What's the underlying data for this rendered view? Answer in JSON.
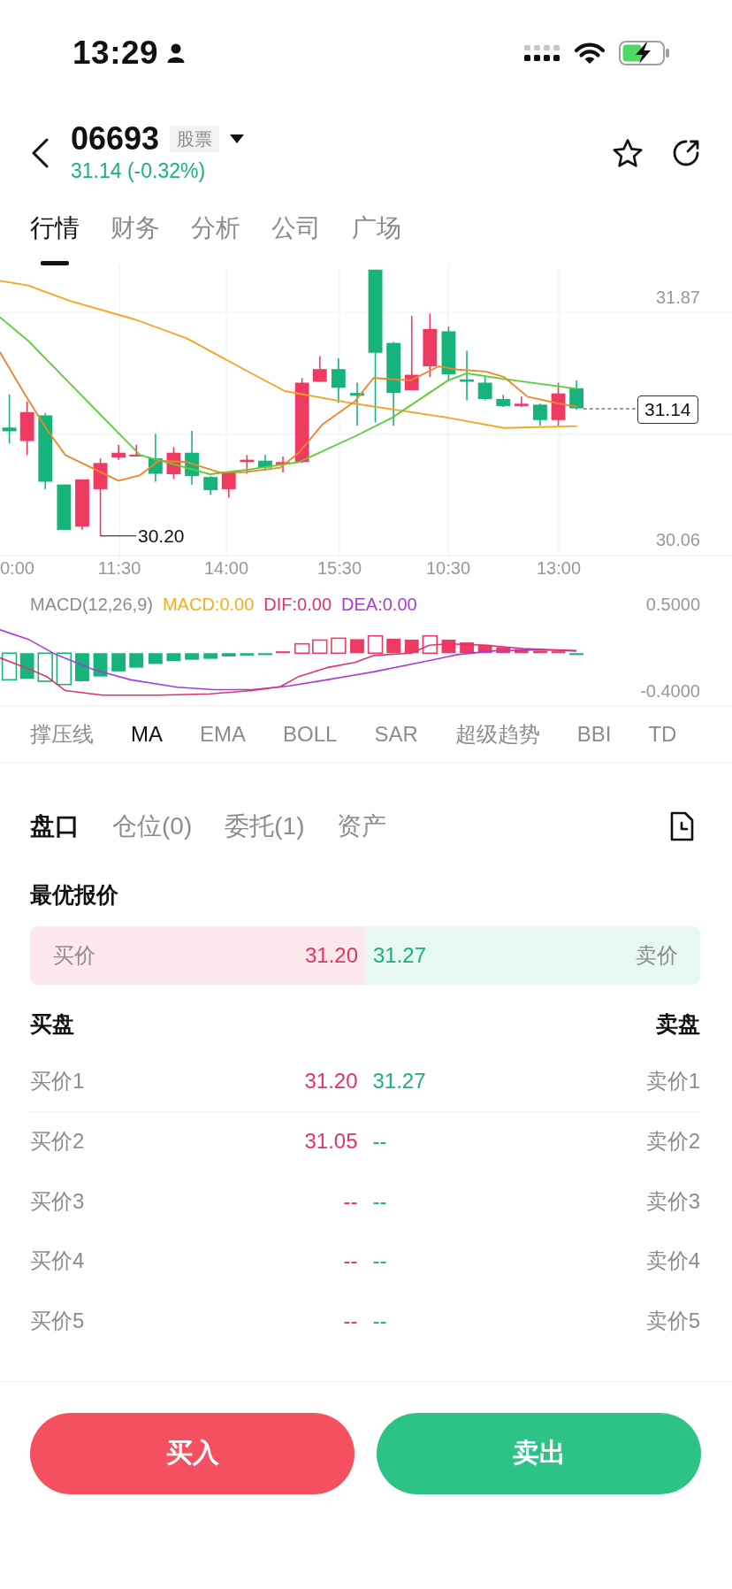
{
  "status_bar": {
    "time": "13:29"
  },
  "header": {
    "symbol": "06693",
    "badge": "股票",
    "price": "31.14 (-0.32%)"
  },
  "tabs": [
    {
      "label": "行情",
      "selected": true
    },
    {
      "label": "财务",
      "selected": false
    },
    {
      "label": "分析",
      "selected": false
    },
    {
      "label": "公司",
      "selected": false
    },
    {
      "label": "广场",
      "selected": false
    }
  ],
  "chart": {
    "price_labels": [
      "31.87",
      "30.06"
    ],
    "current_price": "31.14",
    "low_price": "30.20",
    "time_labels": [
      "0:00",
      "11:30",
      "14:00",
      "15:30",
      "10:30",
      "13:00"
    ]
  },
  "macd": {
    "legend": [
      {
        "label": "MACD(12,26,9)",
        "color": "#8c8c8c"
      },
      {
        "label": "MACD:0.00",
        "color": "#f2b01e"
      },
      {
        "label": "DIF:0.00",
        "color": "#e3306f"
      },
      {
        "label": "DEA:0.00",
        "color": "#a43ce0"
      }
    ],
    "scale_labels": [
      "0.5000",
      "-0.4000"
    ]
  },
  "indicators": [
    {
      "label": "撑压线",
      "selected": false
    },
    {
      "label": "MA",
      "selected": true
    },
    {
      "label": "EMA",
      "selected": false
    },
    {
      "label": "BOLL",
      "selected": false
    },
    {
      "label": "SAR",
      "selected": false
    },
    {
      "label": "超级趋势",
      "selected": false
    },
    {
      "label": "BBI",
      "selected": false
    },
    {
      "label": "TD",
      "selected": false
    }
  ],
  "panel_tabs": [
    {
      "label": "盘口",
      "selected": true
    },
    {
      "label": "仓位(0)",
      "selected": false
    },
    {
      "label": "委托(1)",
      "selected": false
    },
    {
      "label": "资产",
      "selected": false
    }
  ],
  "best_quote": {
    "title": "最优报价",
    "bid_label": "买价",
    "bid": "31.20",
    "ask": "31.27",
    "ask_label": "卖价"
  },
  "order_book": {
    "bid_title": "买盘",
    "ask_title": "卖盘",
    "rows": [
      {
        "bid_label": "买价1",
        "bid": "31.20",
        "ask": "31.27",
        "ask_label": "卖价1"
      },
      {
        "bid_label": "买价2",
        "bid": "31.05",
        "ask": "--",
        "ask_label": "卖价2"
      },
      {
        "bid_label": "买价3",
        "bid": "--",
        "ask": "--",
        "ask_label": "卖价3"
      },
      {
        "bid_label": "买价4",
        "bid": "--",
        "ask": "--",
        "ask_label": "卖价4"
      },
      {
        "bid_label": "买价5",
        "bid": "--",
        "ask": "--",
        "ask_label": "卖价5"
      }
    ]
  },
  "actions": [
    {
      "label": "买入",
      "kind": "buy"
    },
    {
      "label": "卖出",
      "kind": "sell"
    }
  ]
}
